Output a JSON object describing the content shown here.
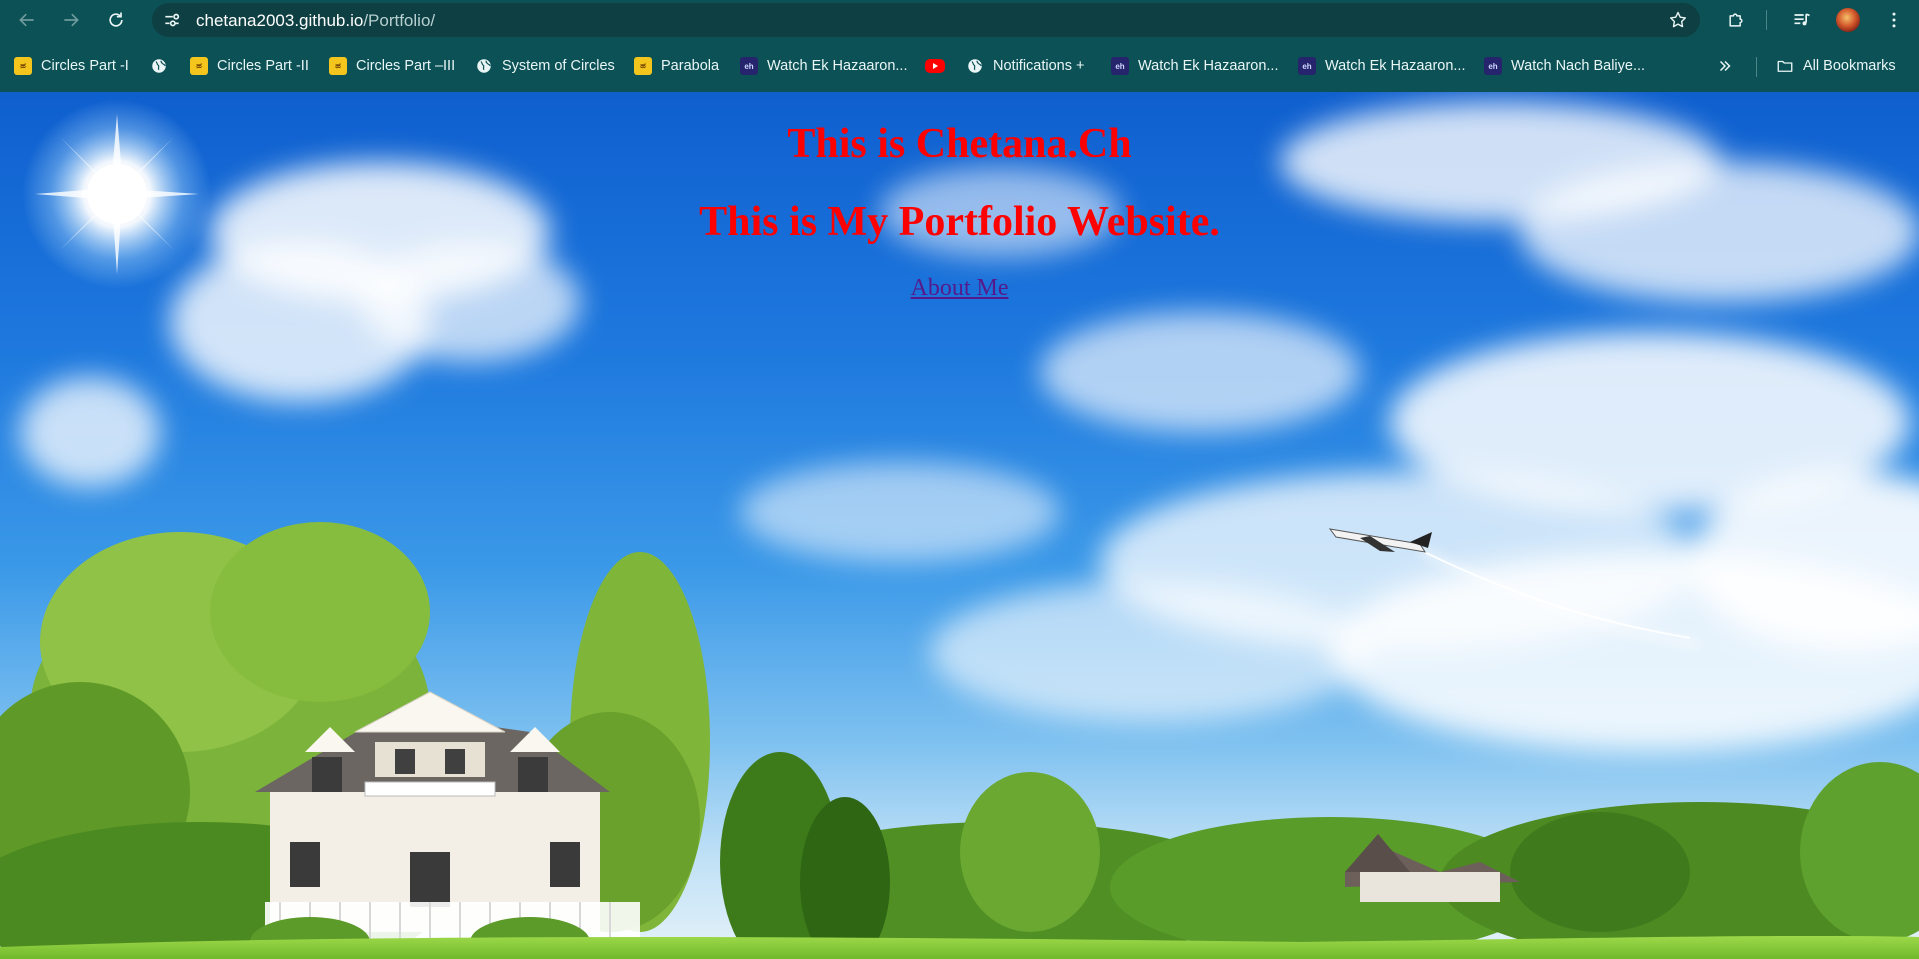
{
  "browser": {
    "url_host": "chetana2003.github.io",
    "url_path": "/Portfolio/",
    "bookmarks": [
      {
        "label": "Circles Part -I",
        "icon": "yellow-site-icon"
      },
      {
        "label": "",
        "icon": "globe-icon"
      },
      {
        "label": "Circles Part -II",
        "icon": "yellow-site-icon"
      },
      {
        "label": "Circles Part –III",
        "icon": "yellow-site-icon"
      },
      {
        "label": "System of Circles",
        "icon": "globe-icon"
      },
      {
        "label": "Parabola",
        "icon": "yellow-site-icon"
      },
      {
        "label": "Watch Ek Hazaaron...",
        "icon": "eh-site-icon"
      },
      {
        "label": "",
        "icon": "youtube-icon"
      },
      {
        "label": "Notifications +",
        "icon": "globe-icon"
      },
      {
        "label": "Watch Ek Hazaaron...",
        "icon": "eh-site-icon"
      },
      {
        "label": "Watch Ek Hazaaron...",
        "icon": "eh-site-icon"
      },
      {
        "label": "Watch Nach Baliye...",
        "icon": "eh-site-icon"
      }
    ],
    "all_bookmarks_label": "All Bookmarks"
  },
  "page": {
    "heading_1": "This is Chetana.Ch",
    "heading_2": "This is My Portfolio Website.",
    "about_link": "About Me"
  },
  "colors": {
    "chrome_bg": "#0b5155",
    "heading": "#ff0000",
    "visited_link": "#551a8b"
  }
}
